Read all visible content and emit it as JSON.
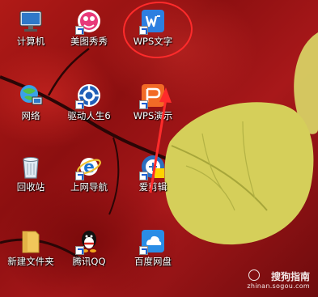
{
  "desktop": {
    "icons": [
      {
        "label": "计算机",
        "icon": "computer-icon"
      },
      {
        "label": "美图秀秀",
        "icon": "meitu-icon"
      },
      {
        "label": "WPS文字",
        "icon": "wps-writer-icon"
      },
      {
        "label": "网络",
        "icon": "network-icon"
      },
      {
        "label": "驱动人生6",
        "icon": "driver-life-icon"
      },
      {
        "label": "WPS演示",
        "icon": "wps-presentation-icon"
      },
      {
        "label": "回收站",
        "icon": "recycle-bin-icon"
      },
      {
        "label": "上网导航",
        "icon": "ie-browser-icon"
      },
      {
        "label": "爱剪辑",
        "icon": "aijianji-icon"
      },
      {
        "label": "新建文件夹",
        "icon": "folder-icon"
      },
      {
        "label": "腾讯QQ",
        "icon": "qq-icon"
      },
      {
        "label": "百度网盘",
        "icon": "baidu-netdisk-icon"
      }
    ]
  },
  "annotation": {
    "color": "#ff2b2b"
  },
  "watermark": {
    "title": "搜狗指南",
    "url": "zhinan.sogou.com"
  }
}
